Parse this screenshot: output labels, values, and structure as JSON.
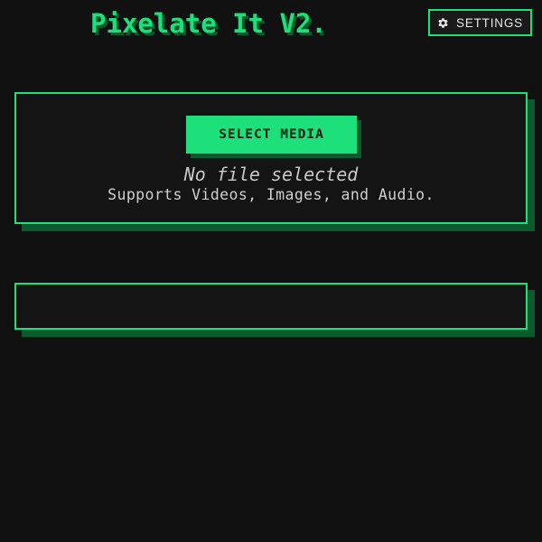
{
  "header": {
    "title": "Pixelate It V2.",
    "settings_label": "SETTINGS",
    "settings_icon": "gear-icon"
  },
  "upload": {
    "select_label": "SELECT MEDIA",
    "file_status": "No file selected",
    "supports_text": "Supports Videos, Images, and Audio."
  },
  "colors": {
    "accent": "#1ee07a",
    "accent_shadow": "#0d5a2f",
    "background": "#111111",
    "text": "#cfcfcf"
  }
}
